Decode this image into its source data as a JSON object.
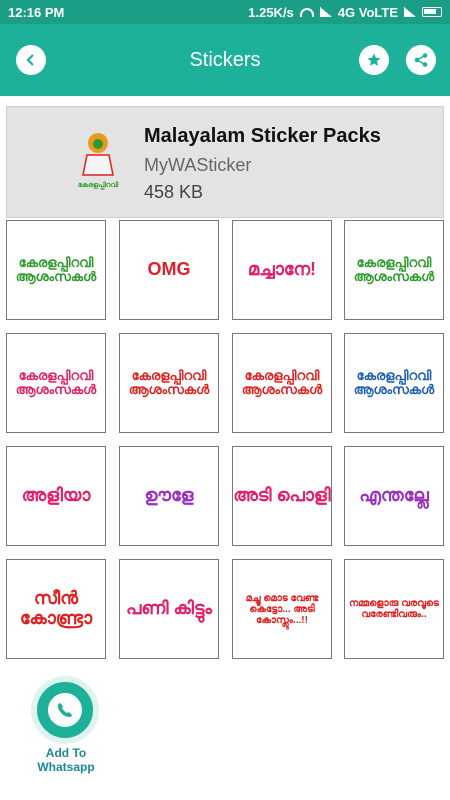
{
  "status_bar": {
    "time": "12:16 PM",
    "speed": "1.25K/s",
    "network": "4G VoLTE"
  },
  "app_bar": {
    "title": "Stickers",
    "back_icon": "chevron-left-icon",
    "favorite_icon": "star-icon",
    "share_icon": "share-icon"
  },
  "pack": {
    "name": "Malayalam Sticker Packs",
    "author": "MyWASticker",
    "size": "458 KB",
    "thumb_text": "കേരളപ്പിറവി"
  },
  "stickers": [
    {
      "text": "കേരളപ്പിറവി ആശംസകൾ",
      "color": "#2a9a2a"
    },
    {
      "text": "OMG",
      "color": "#e0202a"
    },
    {
      "text": "മച്ചാനേ!",
      "color": "#e0206a"
    },
    {
      "text": "കേരളപ്പിറവി ആശംസകൾ",
      "color": "#2a9a2a"
    },
    {
      "text": "കേരളപ്പിറവി ആശംസകൾ",
      "color": "#e0206a"
    },
    {
      "text": "കേരളപ്പിറവി ആശംസകൾ",
      "color": "#e02020"
    },
    {
      "text": "കേരളപ്പിറവി ആശംസകൾ",
      "color": "#e02020"
    },
    {
      "text": "കേരളപ്പിറവി ആശംസകൾ",
      "color": "#1a5fb0"
    },
    {
      "text": "അളിയാ",
      "color": "#e0206a"
    },
    {
      "text": "ഊളേ",
      "color": "#9a30c0"
    },
    {
      "text": "അടി പൊളി",
      "color": "#e0206a"
    },
    {
      "text": "എന്തല്ലേ",
      "color": "#9a30c0"
    },
    {
      "text": "സീൻ കോണ്ട്രാ",
      "color": "#e02020"
    },
    {
      "text": "പണി കിട്ടും",
      "color": "#e0206a"
    },
    {
      "text": "മച്ചൂ മൊട വേണ്ട കെട്ടോ... അടി കോസ്ലും...!!",
      "color": "#e02020"
    },
    {
      "text": "നമ്മളൊരു വരവൂടെ വരേണ്ടിവരും..",
      "color": "#e02020"
    }
  ],
  "fab": {
    "label": "Add To Whatsapp",
    "icon": "whatsapp-icon"
  },
  "colors": {
    "primary": "#1eb19a",
    "status_bar": "#1a9e86"
  }
}
